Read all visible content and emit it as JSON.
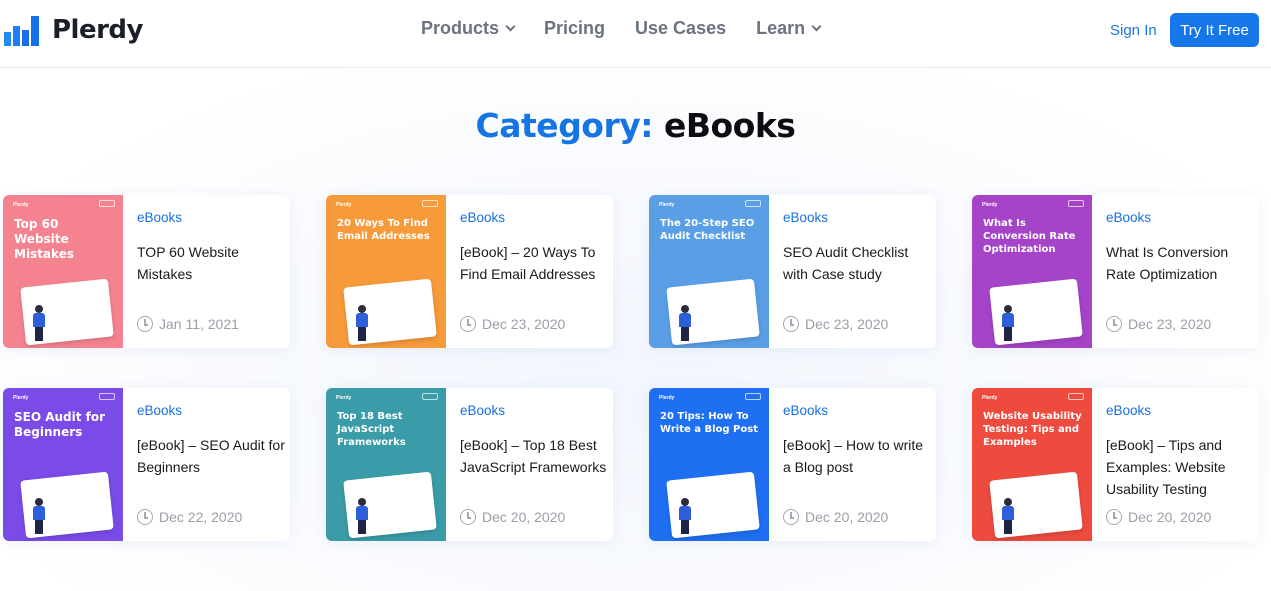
{
  "header": {
    "logo_text": "Plerdy",
    "nav": [
      {
        "label": "Products",
        "has_dropdown": true
      },
      {
        "label": "Pricing",
        "has_dropdown": false
      },
      {
        "label": "Use Cases",
        "has_dropdown": false
      },
      {
        "label": "Learn",
        "has_dropdown": true
      }
    ],
    "sign_in": "Sign In",
    "try_free": "Try It Free"
  },
  "page": {
    "title_prefix": "Category:",
    "title_main": "eBooks"
  },
  "colors": {
    "accent": "#1675e5",
    "button": "#1577ea"
  },
  "cards": [
    {
      "thumb_title": "Top 60 Website Mistakes",
      "thumb_color": "#f5838f",
      "category": "eBooks",
      "title": "TOP 60 Website Mistakes",
      "date": "Jan 11, 2021"
    },
    {
      "thumb_title": "20 Ways To Find Email Addresses",
      "thumb_color": "#f79a3a",
      "category": "eBooks",
      "title": "[eBook] – 20 Ways To Find Email Addresses",
      "date": "Dec 23, 2020"
    },
    {
      "thumb_title": "The 20-Step SEO Audit Checklist",
      "thumb_color": "#5a9fe6",
      "category": "eBooks",
      "title": "SEO Audit Checklist with Case study",
      "date": "Dec 23, 2020"
    },
    {
      "thumb_title": "What Is Conversion Rate Optimization",
      "thumb_color": "#a544c9",
      "category": "eBooks",
      "title": "What Is Conversion Rate Optimization",
      "date": "Dec 23, 2020"
    },
    {
      "thumb_title": "SEO Audit for Beginners",
      "thumb_color": "#7b4be8",
      "category": "eBooks",
      "title": "[eBook] – SEO Audit for Beginners",
      "date": "Dec 22, 2020"
    },
    {
      "thumb_title": "Top 18 Best JavaScript Frameworks",
      "thumb_color": "#3a9ca8",
      "category": "eBooks",
      "title": "[eBook] – Top 18 Best JavaScript Frameworks",
      "date": "Dec 20, 2020"
    },
    {
      "thumb_title": "20 Tips: How To Write a Blog Post",
      "thumb_color": "#1f6ff2",
      "category": "eBooks",
      "title": "[eBook] – How to write a Blog post",
      "date": "Dec 20, 2020"
    },
    {
      "thumb_title": "Website Usability Testing: Tips and Examples",
      "thumb_color": "#ee4b3f",
      "category": "eBooks",
      "title": "[eBook] – Tips and Examples: Website Usability Testing",
      "date": "Dec 20, 2020"
    }
  ]
}
